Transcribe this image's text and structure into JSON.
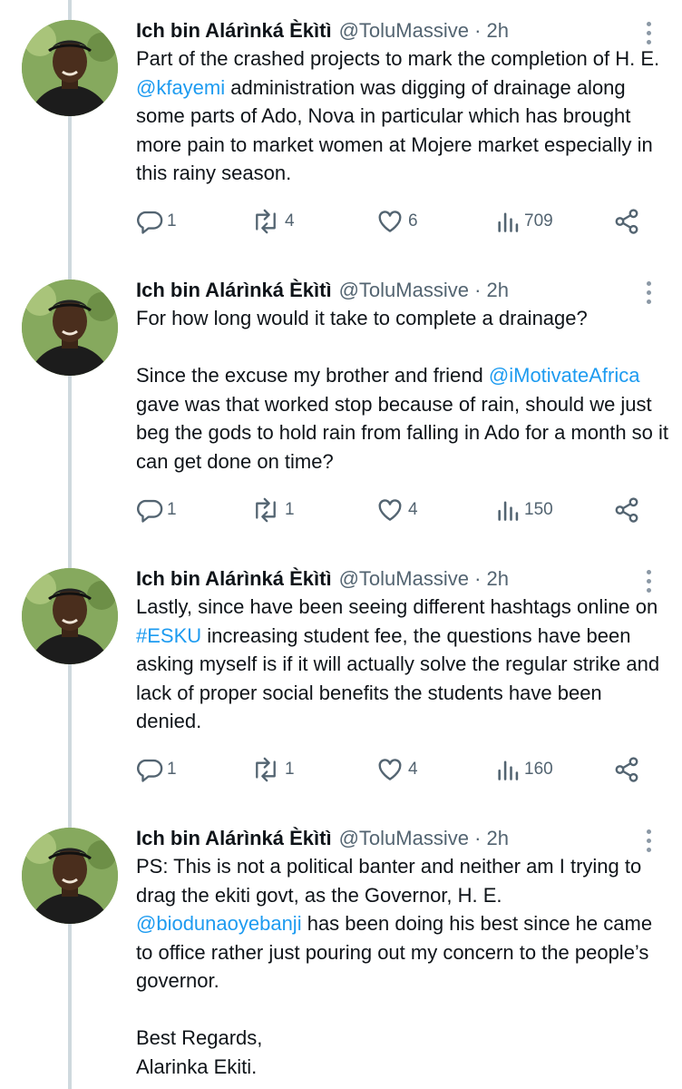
{
  "tweets": [
    {
      "author": "Ich bin Alárìnká Èkìtì",
      "handle": "@ToluMassive · 2h",
      "text_1": "Part of the crashed projects to mark the completion of H. E. ",
      "mention": "@kfayemi",
      "text_2": " administration was digging of drainage along some parts of Ado, Nova in particular which has brought more pain to market women at Mojere market especially in this rainy season.",
      "replies": "1",
      "reposts": "4",
      "likes": "6",
      "views": "709"
    },
    {
      "author": "Ich bin Alárìnká Èkìtì",
      "handle": "@ToluMassive · 2h",
      "line_1": "For how long would it take to complete a drainage?",
      "text_1": "Since the excuse my brother and friend ",
      "mention": "@iMotivateAfrica",
      "text_2": "  gave was that worked stop because of rain, should we just beg the gods to hold rain from falling in Ado for a month so it can get done on time?",
      "replies": "1",
      "reposts": "1",
      "likes": "4",
      "views": "150"
    },
    {
      "author": "Ich bin Alárìnká Èkìtì",
      "handle": "@ToluMassive · 2h",
      "text_1": "Lastly, since have been seeing different hashtags online on ",
      "hashtag": "#ESKU",
      "text_2": " increasing student fee, the questions have been asking myself is if it will actually solve the regular strike and lack of proper social benefits the students have been denied.",
      "replies": "1",
      "reposts": "1",
      "likes": "4",
      "views": "160"
    },
    {
      "author": "Ich bin Alárìnká Èkìtì",
      "handle": "@ToluMassive · 2h",
      "text_1": "PS: This is not a political banter and neither am I trying to drag the ekiti govt, as the Governor, H. E. ",
      "mention": "@biodunaoyebanji",
      "text_2": " has been doing his best since he came to office rather just pouring out my concern to the people’s governor.",
      "signoff_1": "Best Regards,",
      "signoff_2": "Alarinka Ekiti."
    }
  ],
  "icons": {
    "reply": "reply-icon",
    "repost": "repost-icon",
    "like": "like-icon",
    "views": "views-icon",
    "share": "share-icon",
    "more": "more-icon"
  },
  "colors": {
    "text": "#0f1419",
    "secondary": "#536471",
    "link": "#1d9bf0",
    "thread_line": "#cfd9de"
  }
}
